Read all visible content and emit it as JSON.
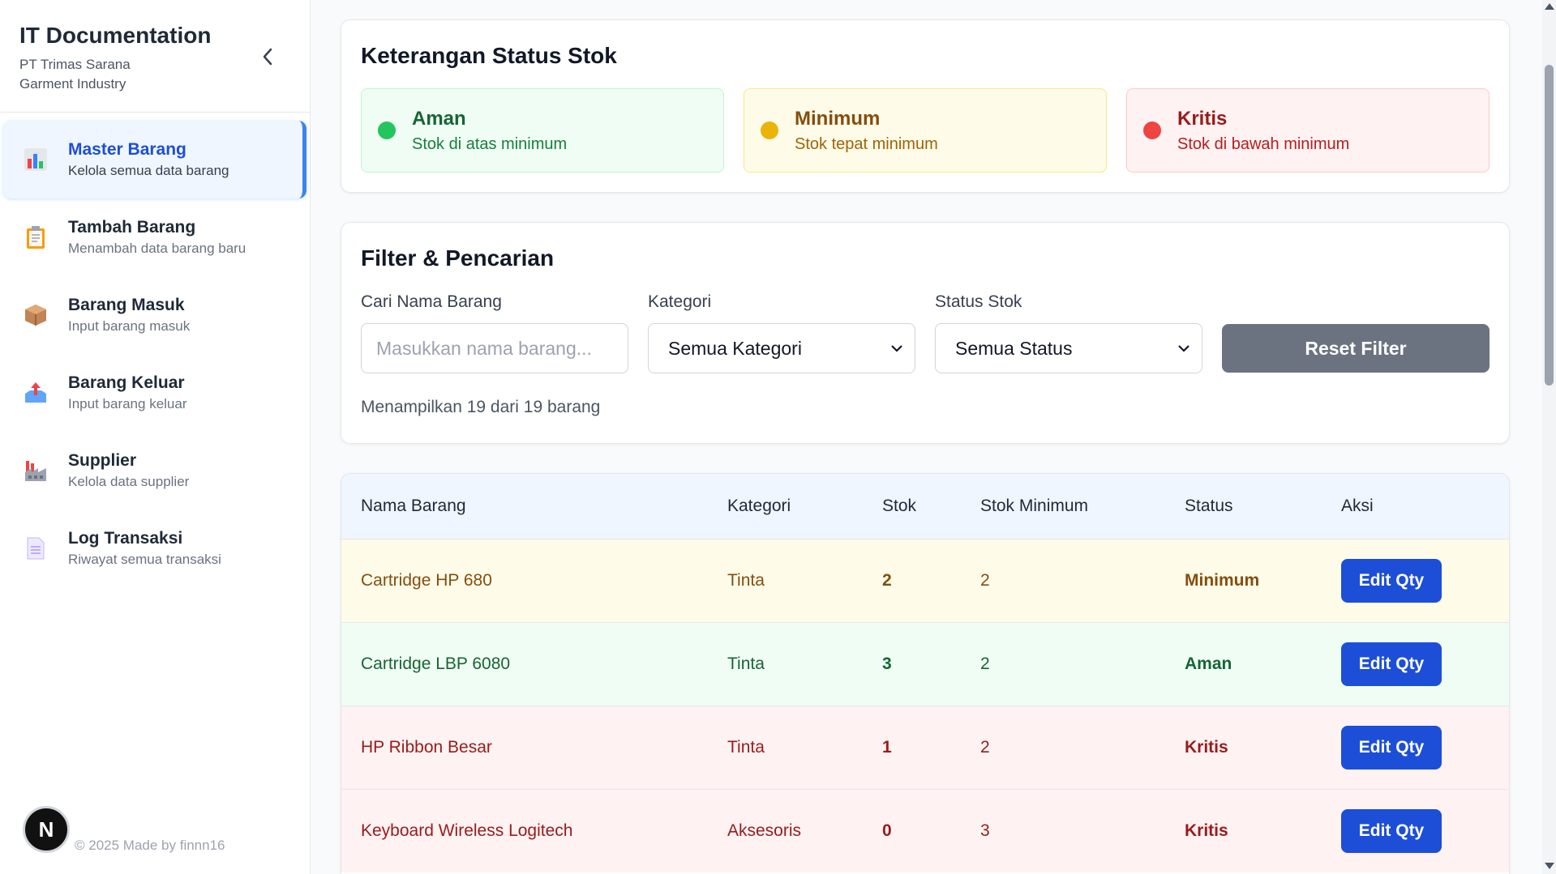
{
  "sidebar": {
    "title": "IT Documentation",
    "subtitle": "PT Trimas Sarana Garment Industry",
    "items": [
      {
        "label": "Master Barang",
        "desc": "Kelola semua data barang",
        "icon": "bar-chart-icon"
      },
      {
        "label": "Tambah Barang",
        "desc": "Menambah data barang baru",
        "icon": "clipboard-icon"
      },
      {
        "label": "Barang Masuk",
        "desc": "Input barang masuk",
        "icon": "package-icon"
      },
      {
        "label": "Barang Keluar",
        "desc": "Input barang keluar",
        "icon": "outbox-tray-icon"
      },
      {
        "label": "Supplier",
        "desc": "Kelola data supplier",
        "icon": "factory-icon"
      },
      {
        "label": "Log Transaksi",
        "desc": "Riwayat semua transaksi",
        "icon": "document-icon"
      }
    ],
    "footer": "© 2025 Made by finnn16",
    "badge": "N"
  },
  "legend": {
    "title": "Keterangan Status Stok",
    "aman": {
      "name": "Aman",
      "desc": "Stok di atas minimum",
      "color": "#22c55e"
    },
    "minimum": {
      "name": "Minimum",
      "desc": "Stok tepat minimum",
      "color": "#eab308"
    },
    "kritis": {
      "name": "Kritis",
      "desc": "Stok di bawah minimum",
      "color": "#ef4444"
    }
  },
  "filter": {
    "title": "Filter & Pencarian",
    "search_label": "Cari Nama Barang",
    "search_placeholder": "Masukkan nama barang...",
    "kategori_label": "Kategori",
    "kategori_value": "Semua Kategori",
    "status_label": "Status Stok",
    "status_value": "Semua Status",
    "reset_label": "Reset Filter",
    "count_text": "Menampilkan 19 dari 19 barang"
  },
  "table": {
    "headers": [
      "Nama Barang",
      "Kategori",
      "Stok",
      "Stok Minimum",
      "Status",
      "Aksi"
    ],
    "rows": [
      {
        "nama": "Cartridge HP 680",
        "kategori": "Tinta",
        "stok": "2",
        "stok_min": "2",
        "status": "Minimum",
        "aksi": "Edit Qty"
      },
      {
        "nama": "Cartridge LBP 6080",
        "kategori": "Tinta",
        "stok": "3",
        "stok_min": "2",
        "status": "Aman",
        "aksi": "Edit Qty"
      },
      {
        "nama": "HP Ribbon Besar",
        "kategori": "Tinta",
        "stok": "1",
        "stok_min": "2",
        "status": "Kritis",
        "aksi": "Edit Qty"
      },
      {
        "nama": "Keyboard Wireless Logitech",
        "kategori": "Aksesoris",
        "stok": "0",
        "stok_min": "3",
        "status": "Kritis",
        "aksi": "Edit Qty"
      }
    ]
  }
}
